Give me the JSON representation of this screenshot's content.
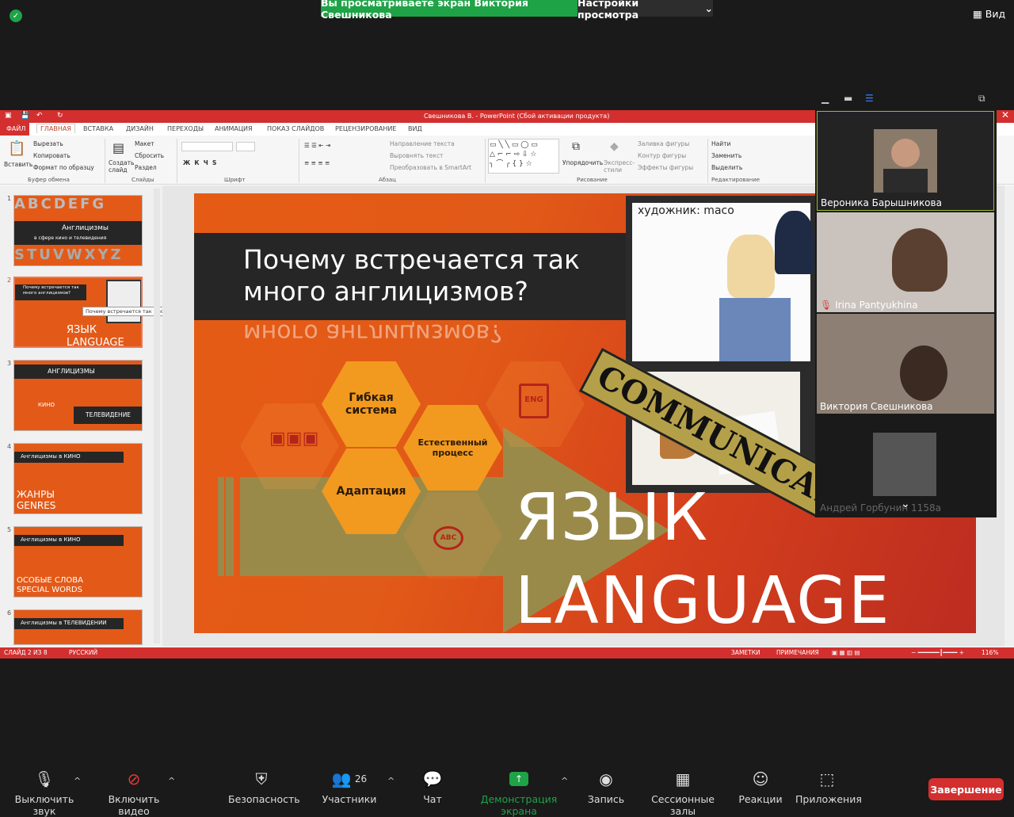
{
  "zoom_top": {
    "share_banner": "Вы просматриваете экран Виктория Свешникова",
    "view_options": "Настройки просмотра",
    "view_button": "Вид"
  },
  "powerpoint": {
    "window_title": "Свешникова В. - PowerPoint (Сбой активации продукта)",
    "tabs": [
      "ФАЙЛ",
      "ГЛАВНАЯ",
      "ВСТАВКА",
      "ДИЗАЙН",
      "ПЕРЕХОДЫ",
      "АНИМАЦИЯ",
      "ПОКАЗ СЛАЙДОВ",
      "РЕЦЕНЗИРОВАНИЕ",
      "ВИД"
    ],
    "ribbon": {
      "paste": "Вставить",
      "cut": "Вырезать",
      "copy": "Копировать",
      "format_painter": "Формат по образцу",
      "clipboard_group": "Буфер обмена",
      "new_slide": "Создать слайд",
      "layout": "Макет",
      "reset": "Сбросить",
      "section": "Раздел",
      "slides_group": "Слайды",
      "font_group": "Шрифт",
      "text_direction": "Направление текста",
      "align_text": "Выровнять текст",
      "smartart": "Преобразовать в SmartArt",
      "paragraph_group": "Абзац",
      "arrange": "Упорядочить",
      "quick_styles": "Экспресс-стили",
      "shape_fill": "Заливка фигуры",
      "shape_outline": "Контур фигуры",
      "shape_effects": "Эффекты фигуры",
      "drawing_group": "Рисование",
      "find": "Найти",
      "replace": "Заменить",
      "select": "Выделить",
      "editing_group": "Редактирование"
    },
    "thumbnails": [
      {
        "num": "1",
        "title": "Англицизмы",
        "subtitle": "в сфере кино и телевидения"
      },
      {
        "num": "2",
        "title": "Почему встречается так много англицизмов?",
        "big1": "ЯЗЫК",
        "big2": "LANGUAGE",
        "tooltip": "Почему встречается так мног..."
      },
      {
        "num": "3",
        "title": "АНГЛИЦИЗМЫ",
        "a": "КИНО",
        "b": "ТЕЛЕВИДЕНИЕ"
      },
      {
        "num": "4",
        "title": "Англицизмы в КИНО",
        "big1": "ЖАНРЫ",
        "big2": "GENRES"
      },
      {
        "num": "5",
        "title": "Англицизмы в КИНО",
        "big1": "ОСОБЫЕ СЛОВА",
        "big2": "SPECIAL WORDS"
      },
      {
        "num": "6",
        "title": "Англицизмы в ТЕЛЕВИДЕНИИ"
      }
    ],
    "slide": {
      "title": "Почему встречается так много англицизмов?",
      "reflection": "много англицизмов?",
      "hex_flexible": "Гибкая система",
      "hex_natural": "Естественный процесс",
      "hex_adapt": "Адаптация",
      "icon_eng": "ENG",
      "icon_abc": "ABC",
      "artist": "художник: maco",
      "communication": "COMMUNICATION",
      "big_ru": "ЯЗЫК",
      "big_en": "LANGUAGE"
    },
    "status": {
      "slide_of": "СЛАЙД 2 ИЗ 8",
      "language": "РУССКИЙ",
      "notes": "ЗАМЕТКИ",
      "comments": "ПРИМЕЧАНИЯ",
      "zoom": "116%"
    }
  },
  "participants": [
    {
      "name": "Вероника Барышникова"
    },
    {
      "name": "Irina Pantyukhina"
    },
    {
      "name": "Виктория Свешникова"
    },
    {
      "name": "Андрей Горбунин 1158а"
    }
  ],
  "zoom_bottom": {
    "mute": "Выключить звук",
    "video": "Включить видео",
    "security": "Безопасность",
    "participants": "Участники",
    "participants_count": "26",
    "chat": "Чат",
    "share": "Демонстрация экрана",
    "record": "Запись",
    "breakout": "Сессионные залы",
    "reactions": "Реакции",
    "apps": "Приложения",
    "end": "Завершение"
  },
  "colors": {
    "zoom_green": "#1fa347",
    "ppt_red": "#d32f2f",
    "slide_orange": "#e55b16",
    "hex_orange": "#f29a1f",
    "olive": "#9a8a4a"
  }
}
